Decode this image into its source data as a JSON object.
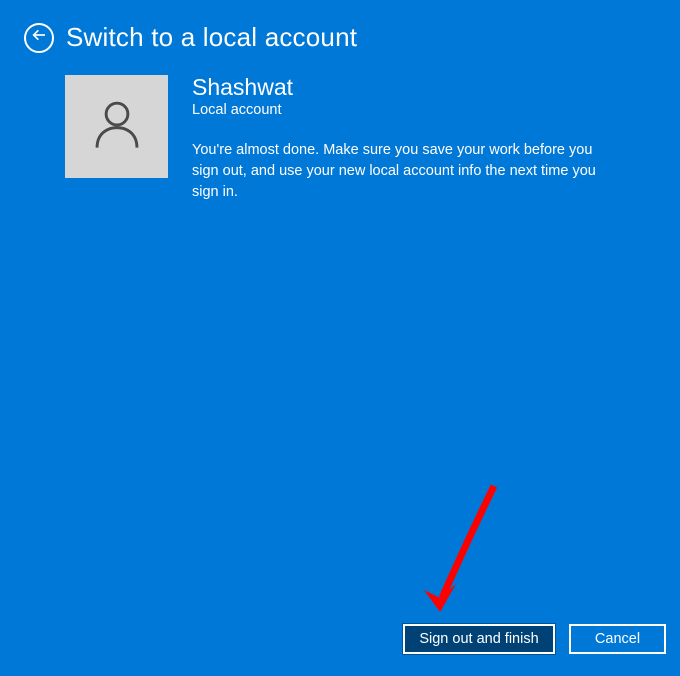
{
  "header": {
    "title": "Switch to a local account"
  },
  "user": {
    "name": "Shashwat",
    "account_type": "Local account",
    "description": "You're almost done. Make sure you save your work before you sign out, and use your new local account info the next time you sign in."
  },
  "buttons": {
    "primary": "Sign out and finish",
    "secondary": "Cancel"
  }
}
